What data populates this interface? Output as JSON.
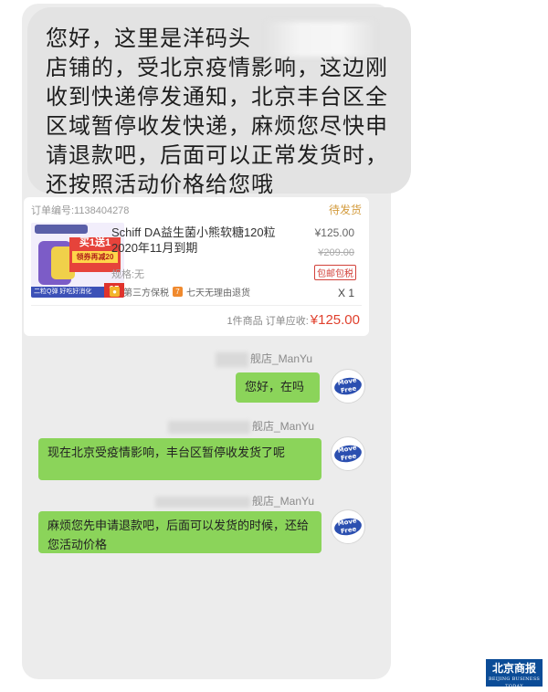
{
  "top_message": {
    "text": "您好，这里是洋码头　　　　　　店铺的，受北京疫情影响，这边刚收到快递停发通知，北京丰台区全区域暂停收发快递，麻烦您尽快申请退款吧，后面可以正常发货时，还按照活动价格给您哦"
  },
  "order_card": {
    "order_number": "订单编号:1138404278",
    "status": "待发货",
    "product_title": "Schiff DA益生菌小熊软糖120粒 2020年11月到期",
    "spec": "规格:无",
    "tag1_icon": "shield-icon",
    "tag1": "第三方保税",
    "tag2_icon": "seven-icon",
    "tag2": "七天无理由退货",
    "price": "¥125.00",
    "original_price": "¥209.00",
    "shipping_badge": "包邮包税",
    "quantity": "X 1",
    "summary_label": "1件商品  订单应收:",
    "summary_amount": "¥125.00",
    "thumbnail": {
      "promo_main": "买1送1",
      "promo_sub": "领券再减20",
      "band_text": "二粒Q弹 好吃好消化",
      "badge": "95"
    }
  },
  "chat": [
    {
      "sender": "舰店_ManYu",
      "text": "您好，在吗"
    },
    {
      "sender": "舰店_ManYu",
      "text": "现在北京受疫情影响，丰台区暂停收发货了呢"
    },
    {
      "sender": "舰店_ManYu",
      "text": "麻烦您先申请退款吧，后面可以发货的时候，还给您活动价格"
    }
  ],
  "avatar_logo": {
    "line1": "Move",
    "line2": "Free"
  },
  "watermark": {
    "cn": "北京商报",
    "en": "BEIJING BUSINESS TODAY"
  },
  "colors": {
    "bubble_green": "#8bd45a",
    "price_red": "#e0402d",
    "status_orange": "#d39b3c"
  }
}
